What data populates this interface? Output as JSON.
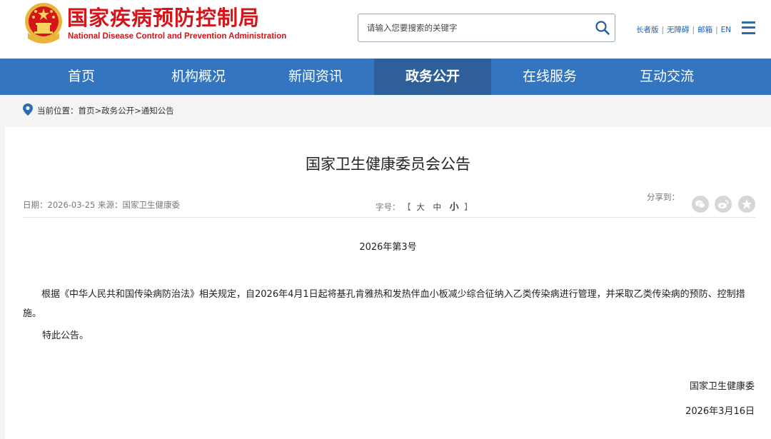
{
  "header": {
    "title": "国家疾病预防控制局",
    "subtitle": "National Disease Control and Prevention Administration",
    "search_placeholder": "请输入您要搜索的关键字",
    "links": [
      "长者版",
      "无障碍",
      "邮箱",
      "EN"
    ],
    "brand_color": "#d7141a"
  },
  "nav": {
    "items": [
      "首页",
      "机构概况",
      "新闻资讯",
      "政务公开",
      "在线服务",
      "互动交流"
    ],
    "active": "政务公开",
    "color": "#3475c0",
    "active_color": "#2e5f98"
  },
  "breadcrumb": {
    "label": "当前位置：",
    "items": [
      "首页",
      "政务公开",
      "通知公告"
    ],
    "separator": ">"
  },
  "article": {
    "title": "国家卫生健康委员会公告",
    "meta": {
      "date_label": "日期：",
      "date": "2026-03-25",
      "source_label": "来源：",
      "source": "国家卫生健康委",
      "font_size_label": "字号：",
      "font_size_open": "【",
      "font_sizes": [
        "大",
        "中",
        "小"
      ],
      "font_size_close": "】",
      "share_label": "分享到："
    },
    "share_icons": [
      "wechat-icon",
      "weibo-icon",
      "qzone-icon"
    ],
    "doc_number": "2026年第3号",
    "paragraphs": [
      "根据《中华人民共和国传染病防治法》相关规定，自2026年4月1日起将基孔肯雅热和发热伴血小板减少综合征纳入乙类传染病进行管理，并采取乙类传染病的预防、控制措施。"
    ],
    "closing": "特此公告。",
    "signature": "国家卫生健康委",
    "sign_date": "2026年3月16日"
  }
}
